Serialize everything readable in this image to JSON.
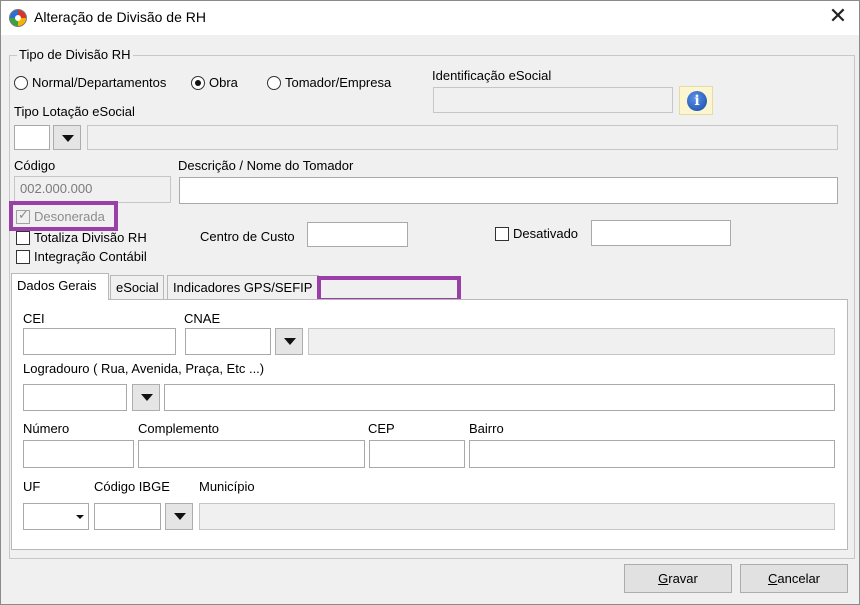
{
  "window": {
    "title": "Alteração de Divisão de RH",
    "close_glyph": "✕",
    "icon": "app-logo-icon"
  },
  "tipo_divisao": {
    "title": "Tipo de Divisão RH",
    "options": [
      "Normal/Departamentos",
      "Obra",
      "Tomador/Empresa"
    ],
    "selected": "Obra"
  },
  "identificacao": {
    "label": "Identificação eSocial",
    "value": "",
    "info_glyph": "i"
  },
  "tipo_lotacao": {
    "label": "Tipo Lotação eSocial",
    "code": "",
    "description": ""
  },
  "codigo": {
    "label": "Código",
    "value": "002.000.000"
  },
  "descricao": {
    "label": "Descrição / Nome do Tomador",
    "value": ""
  },
  "checks": {
    "desonerada": "Desonerada",
    "totaliza": "Totaliza Divisão RH",
    "integracao": "Integração Contábil",
    "desativado": "Desativado",
    "check_glyph": "✓"
  },
  "centro_custo": {
    "label": "Centro de Custo",
    "value": ""
  },
  "tabs": [
    "Dados Gerais",
    "eSocial",
    "Indicadores GPS/SEFIP"
  ],
  "dados_gerais": {
    "cei": "CEI",
    "cnae": "CNAE",
    "logradouro": "Logradouro ( Rua, Avenida, Praça, Etc ...)",
    "numero": "Número",
    "complemento": "Complemento",
    "cep": "CEP",
    "bairro": "Bairro",
    "uf": "UF",
    "codigo_ibge": "Código IBGE",
    "municipio": "Município"
  },
  "buttons": {
    "gravar": {
      "accel": "G",
      "rest": "ravar"
    },
    "cancelar": {
      "accel": "C",
      "rest": "ancelar"
    }
  },
  "colors": {
    "highlight": "#9a3fa8",
    "info_button_bg": "#fbf5d2"
  }
}
